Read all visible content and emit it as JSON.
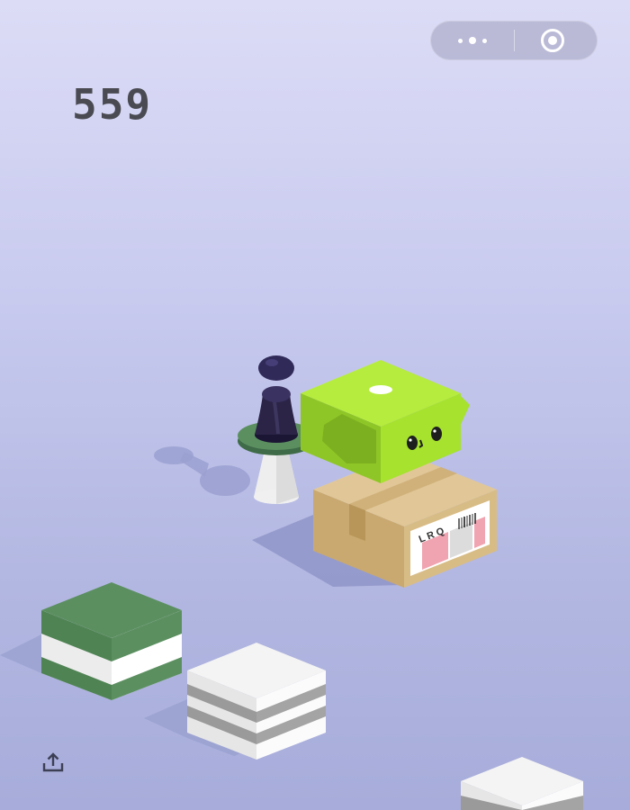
{
  "game": {
    "score": "559"
  },
  "capsule": {
    "more_icon": "more-dots-icon",
    "close_icon": "target-ring-icon"
  },
  "footer": {
    "share_icon": "share-upload-icon"
  },
  "parcel": {
    "label_text": "L R Q"
  },
  "colors": {
    "background_top": "#dcdcf6",
    "background_bottom": "#a7acda",
    "score": "#4a4a52",
    "lime_cube": "#a6e22e",
    "cardboard": "#d4b784",
    "green_block": "#5b8f60",
    "white_block": "#f2f2f2",
    "player": "#2b2446"
  }
}
